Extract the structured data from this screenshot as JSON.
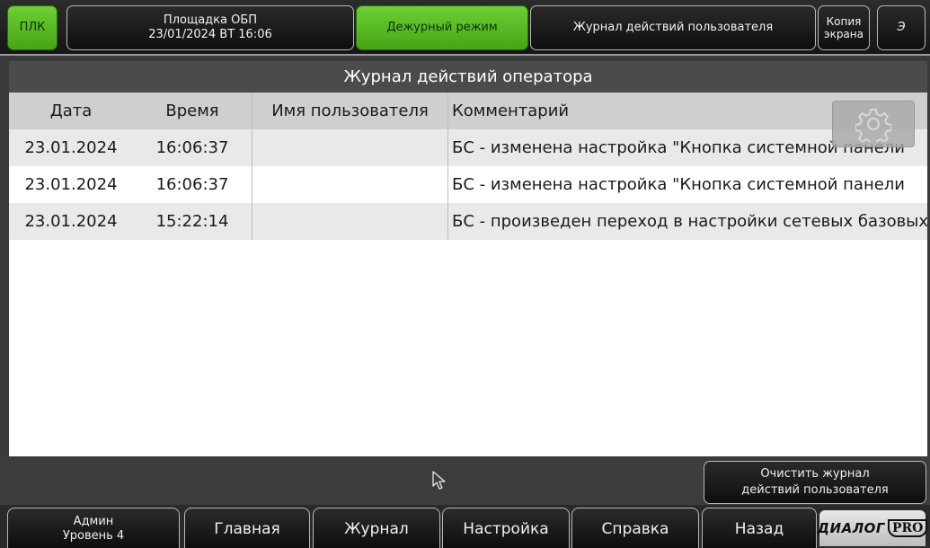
{
  "topbar": {
    "plk": "ПЛК",
    "site_name": "Площадка ОБП",
    "datetime": "23/01/2024 ВТ 16:06",
    "duty_mode": "Дежурный режим",
    "user_log": "Журнал действий пользователя",
    "copy_line1": "Копия",
    "copy_line2": "экрана",
    "e_button": "Э"
  },
  "journal": {
    "title": "Журнал действий оператора",
    "columns": [
      "Дата",
      "Время",
      "Имя пользователя",
      "Комментарий"
    ],
    "rows": [
      {
        "date": "23.01.2024",
        "time": "16:06:37",
        "user": "",
        "comment": "БС - изменена настройка \"Кнопка системной панели"
      },
      {
        "date": "23.01.2024",
        "time": "16:06:37",
        "user": "",
        "comment": "БС - изменена настройка \"Кнопка системной панели"
      },
      {
        "date": "23.01.2024",
        "time": "15:22:14",
        "user": "",
        "comment": "БС - произведен переход в настройки сетевых базовых"
      }
    ]
  },
  "actions": {
    "clear_line1": "Очистить журнал",
    "clear_line2": "действий пользователя"
  },
  "nav": {
    "admin_name": "Админ",
    "admin_level": "Уровень 4",
    "main": "Главная",
    "log": "Журнал",
    "settings": "Настройка",
    "help": "Справка",
    "back": "Назад",
    "logo_text": "ДИАЛОГ",
    "logo_pro": "PRO"
  },
  "colors": {
    "active_green": "#5ac226",
    "panel_header": "#4b4b4b",
    "column_header": "#cfcfcf"
  },
  "icons": [
    "gear-icon",
    "cursor-icon"
  ]
}
